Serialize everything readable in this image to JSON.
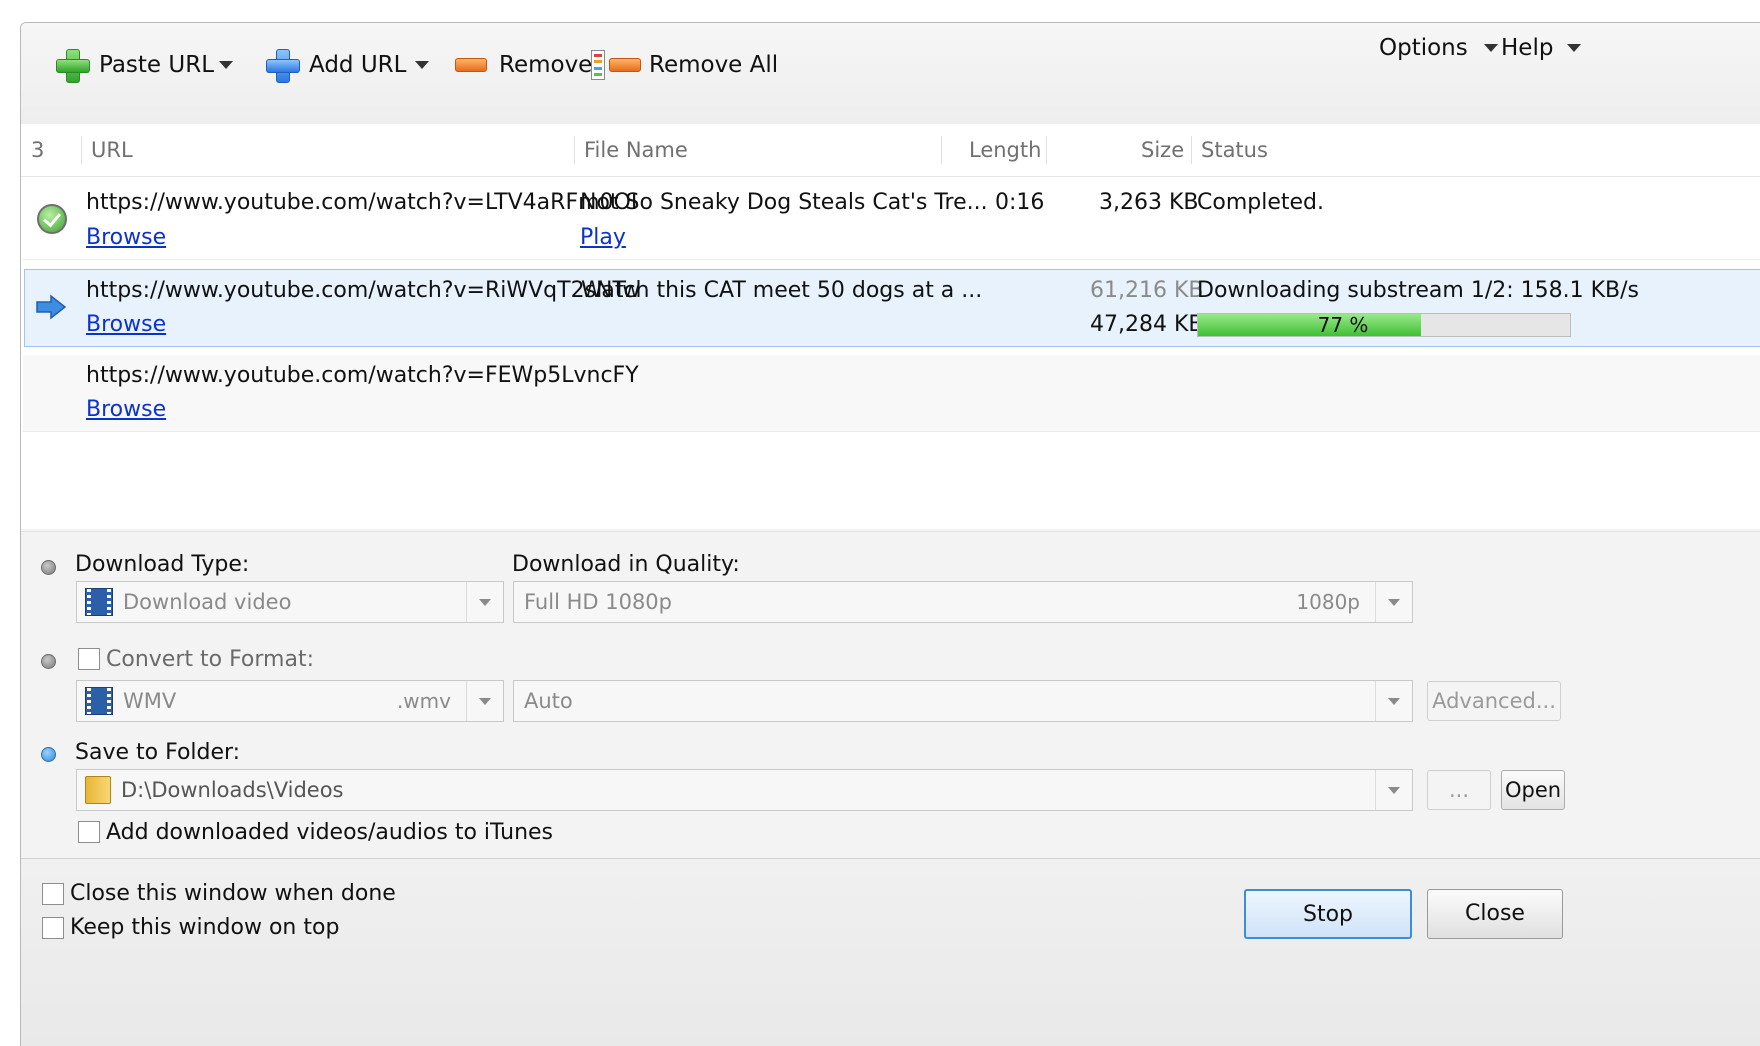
{
  "toolbar": {
    "paste_url": "Paste URL",
    "add_url": "Add URL",
    "remove": "Remove",
    "remove_all": "Remove All",
    "options": "Options",
    "help": "Help"
  },
  "columns": {
    "count": "3",
    "url": "URL",
    "file_name": "File Name",
    "length": "Length",
    "size": "Size",
    "status": "Status"
  },
  "rows": [
    {
      "url": "https://www.youtube.com/watch?v=LTV4aRFm0OI",
      "action": "Browse",
      "file_name": "Not So Sneaky Dog Steals Cat's Tre...",
      "file_action": "Play",
      "length": "0:16",
      "size": "3,263 KB",
      "status": "Completed.",
      "state_icon": "check-icon"
    },
    {
      "url": "https://www.youtube.com/watch?v=RiWVqT2sNTw",
      "action": "Browse",
      "file_name": "Watch this CAT meet 50 dogs at a ...",
      "size_total": "61,216 KB",
      "size_done": "47,284 KB",
      "status": "Downloading substream 1/2: 158.1 KB/s",
      "progress_label": "77 %",
      "progress": 0.77,
      "state_icon": "arrow-right-icon"
    },
    {
      "url": "https://www.youtube.com/watch?v=FEWp5LvncFY",
      "action": "Browse"
    }
  ],
  "options": {
    "download_type_label": "Download Type:",
    "download_type_value": "Download video",
    "quality_label": "Download in Quality:",
    "quality_value": "Full HD 1080p",
    "quality_short": "1080p",
    "convert_label": "Convert to Format:",
    "format_value": "WMV",
    "format_ext": ".wmv",
    "format_preset": "Auto",
    "advanced_button": "Advanced...",
    "save_label": "Save to Folder:",
    "folder_path": "D:\\Downloads\\Videos",
    "browse_button": "...",
    "open_button": "Open",
    "itunes_label": "Add downloaded videos/audios to iTunes"
  },
  "bottom": {
    "close_when_done": "Close this window when done",
    "keep_on_top": "Keep this window on top",
    "stop_button": "Stop",
    "close_button": "Close"
  },
  "colors": {
    "accent": "#3c8ed6",
    "progress": "#4cc23f",
    "link": "#0b33cc",
    "selected_row": "#e7f2fd"
  }
}
